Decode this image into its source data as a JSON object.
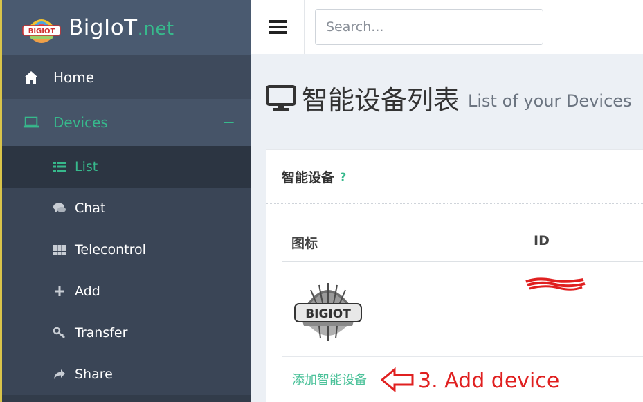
{
  "brand": {
    "name": "BigIoT",
    "suffix": ".net",
    "logo_text": "BIGIOT"
  },
  "sidebar": {
    "home_label": "Home",
    "devices_label": "Devices",
    "devices_toggle": "−",
    "sub_items": [
      {
        "label": "List",
        "icon": "list-icon",
        "active": true
      },
      {
        "label": "Chat",
        "icon": "chat-icon",
        "active": false
      },
      {
        "label": "Telecontrol",
        "icon": "grid-icon",
        "active": false
      },
      {
        "label": "Add",
        "icon": "plus-icon",
        "active": false
      },
      {
        "label": "Transfer",
        "icon": "key-icon",
        "active": false
      },
      {
        "label": "Share",
        "icon": "share-icon",
        "active": false
      }
    ]
  },
  "search": {
    "placeholder": "Search..."
  },
  "page": {
    "title_zh": "智能设备列表",
    "title_en": "List of your Devices"
  },
  "card": {
    "title": "智能设备",
    "help": "?",
    "columns": [
      "图标",
      "ID"
    ],
    "row": {
      "logo_text": "BIGIOT"
    },
    "add_link": "添加智能设备"
  },
  "annotation": {
    "text": "3. Add device",
    "color": "#e02020"
  },
  "colors": {
    "accent": "#37b98c",
    "sidebar_bg": "#3e4a5c",
    "active_bg": "#2c3542"
  }
}
